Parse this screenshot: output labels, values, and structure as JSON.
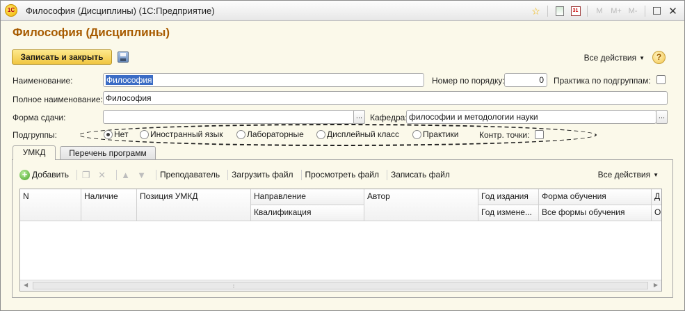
{
  "window": {
    "title": "Философия (Дисциплины)  (1С:Предприятие)",
    "logo_text": "1С",
    "toolbar_m_buttons": [
      "M",
      "M+",
      "M-"
    ],
    "calendar_day": "31"
  },
  "header": {
    "title": "Философия (Дисциплины)",
    "save_close_label": "Записать и закрыть",
    "all_actions_label": "Все действия",
    "help_label": "?"
  },
  "form": {
    "name_label": "Наименование:",
    "name_value": "Философия",
    "order_label": "Номер по порядку:",
    "order_value": "0",
    "practice_label": "Практика по подгруппам:",
    "fullname_label": "Полное наименование:",
    "fullname_value": "Философия",
    "exam_form_label": "Форма сдачи:",
    "exam_form_value": "",
    "dept_label": "Кафедра:",
    "dept_value": "философии и методологии науки",
    "choose_btn": "...",
    "subgroups_label": "Подгруппы:",
    "subgroup_options": [
      "Нет",
      "Иностранный язык",
      "Лабораторные",
      "Дисплейный класс",
      "Практики"
    ],
    "subgroup_selected": "Нет",
    "checkpoints_label": "Контр. точки:"
  },
  "tabs": [
    {
      "label": "УМКД"
    },
    {
      "label": "Перечень программ"
    }
  ],
  "grid_toolbar": {
    "add_label": "Добавить",
    "teacher_label": "Преподаватель",
    "upload_label": "Загрузить файл",
    "view_label": "Просмотреть файл",
    "save_file_label": "Записать файл",
    "all_actions_label": "Все действия"
  },
  "grid": {
    "columns": {
      "n": "N",
      "availability": "Наличие",
      "position": "Позиция УМКД",
      "direction": "Направление",
      "qualification": "Квалификация",
      "author": "Автор",
      "year": "Год издания",
      "year_changed": "Год измене...",
      "study_form": "Форма обучения",
      "all_forms": "Все формы обучения",
      "d": "Д",
      "o": "О"
    }
  }
}
